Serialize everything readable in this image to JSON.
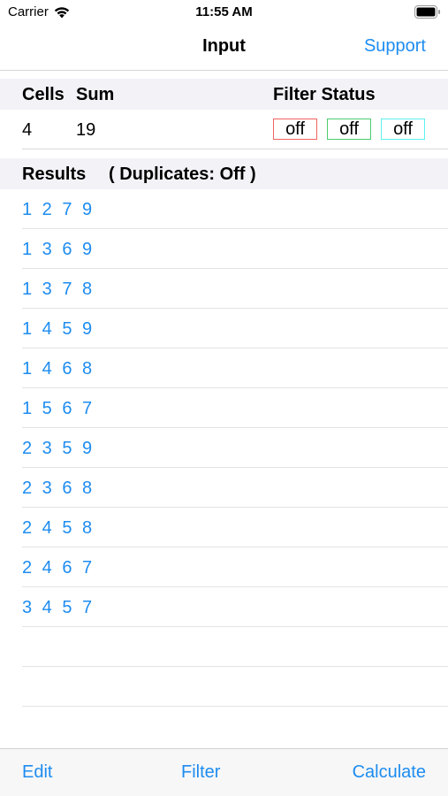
{
  "status_bar": {
    "carrier": "Carrier",
    "time": "11:55 AM",
    "icons": [
      "wifi-icon",
      "battery-icon"
    ]
  },
  "nav": {
    "title": "Input",
    "support_label": "Support"
  },
  "header": {
    "cells_label": "Cells",
    "sum_label": "Sum",
    "filter_status_label": "Filter Status"
  },
  "input": {
    "cells": "4",
    "sum": "19",
    "filters": [
      {
        "label": "off",
        "color": "#f0645f"
      },
      {
        "label": "off",
        "color": "#4ccb6e"
      },
      {
        "label": "off",
        "color": "#5ef0ee"
      }
    ]
  },
  "results_header": {
    "label": "Results",
    "duplicates": "( Duplicates:  Off )"
  },
  "results": [
    "1 2 7 9",
    "1 3 6 9",
    "1 3 7 8",
    "1 4 5 9",
    "1 4 6 8",
    "1 5 6 7",
    "2 3 5 9",
    "2 3 6 8",
    "2 4 5 8",
    "2 4 6 7",
    "3 4 5 7",
    "",
    ""
  ],
  "toolbar": {
    "edit_label": "Edit",
    "filter_label": "Filter",
    "calculate_label": "Calculate"
  },
  "colors": {
    "accent": "#1d8cf0",
    "section_bg": "#f2f2f7"
  }
}
